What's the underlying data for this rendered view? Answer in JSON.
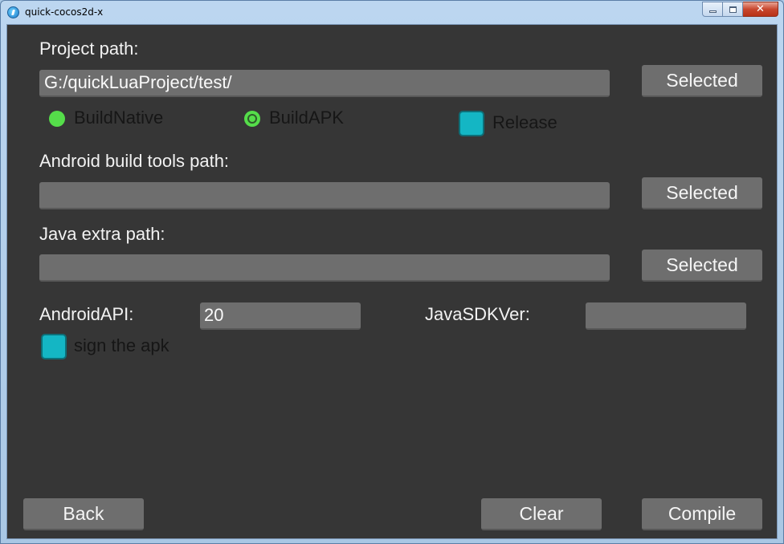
{
  "window": {
    "title": "quick-cocos2d-x"
  },
  "project": {
    "label": "Project path:",
    "path_value": "G:/quickLuaProject/test/",
    "select_label": "Selected"
  },
  "build_options": {
    "native_label": "BuildNative",
    "apk_label": "BuildAPK",
    "selected": "BuildAPK",
    "release_label": "Release"
  },
  "android_tools": {
    "label": "Android build tools path:",
    "path_value": "",
    "select_label": "Selected"
  },
  "java_extra": {
    "label": "Java extra path:",
    "path_value": "",
    "select_label": "Selected"
  },
  "android_api": {
    "label": "AndroidAPI:",
    "value": "20"
  },
  "java_sdk": {
    "label": "JavaSDKVer:",
    "value": ""
  },
  "sign": {
    "label": "sign the apk"
  },
  "footer": {
    "back_label": "Back",
    "clear_label": "Clear",
    "compile_label": "Compile"
  },
  "colors": {
    "background": "#363636",
    "control": "#6e6e6e",
    "radio_accent": "#55dd4a",
    "checkbox_accent": "#14b6c4",
    "text": "#f2f2f2"
  }
}
